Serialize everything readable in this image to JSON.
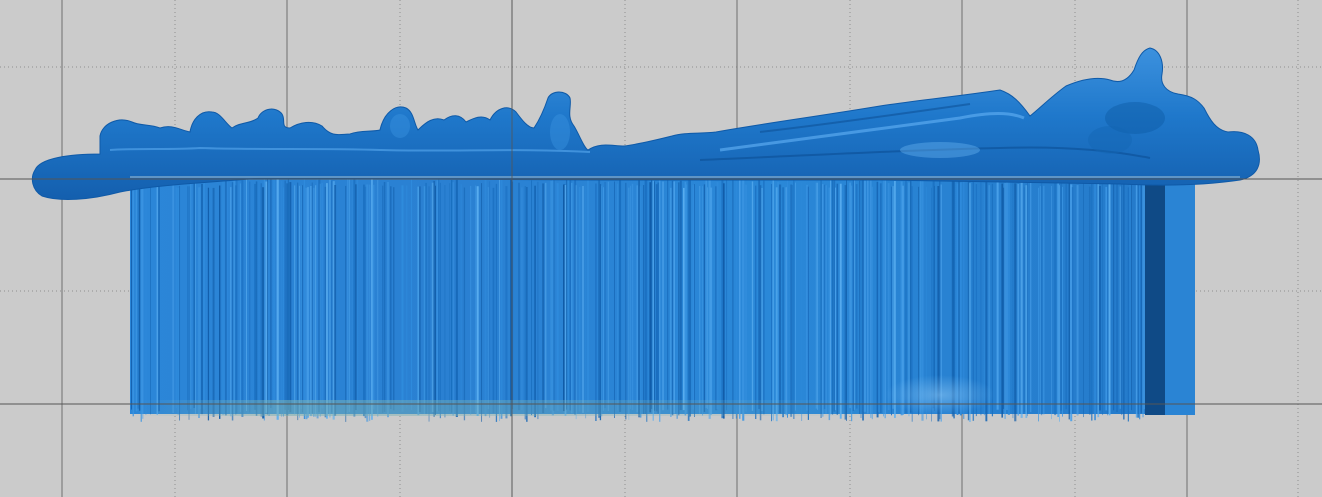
{
  "viewport": {
    "background_color": "#cbcbcb",
    "grid": {
      "enabled": true,
      "major_line_color": "#6f6f6f",
      "minor_line_color": "#8f8f8f",
      "minor_line_style": "dotted"
    },
    "model": {
      "name": "",
      "surface_color": "#1e73c8",
      "highlight_color": "#57a8ea",
      "shadow_color": "#0d4f93",
      "support_color": "#2b86d8",
      "support_base_tint": "#7ab1b4"
    }
  }
}
